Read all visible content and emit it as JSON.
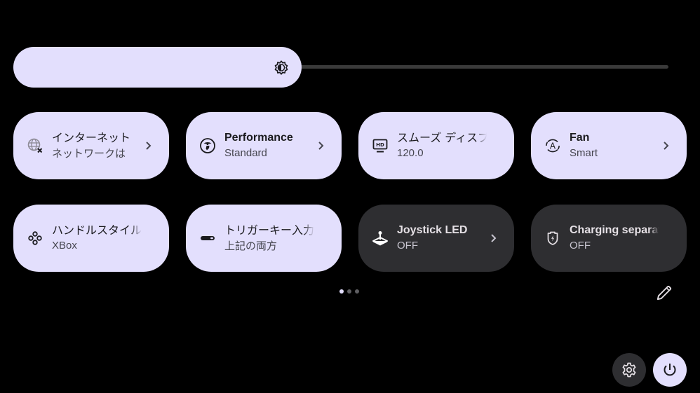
{
  "brightness": {
    "level_percent": 44,
    "icon": "brightness-auto-icon"
  },
  "tiles": [
    {
      "label": "インターネット",
      "sub": "ネットワークは",
      "state": "on",
      "icon": "globe-off-icon",
      "has_chevron": true
    },
    {
      "label": "Performance",
      "sub": "Standard",
      "state": "on",
      "icon": "performance-icon",
      "has_chevron": true
    },
    {
      "label": "スムーズ ディスプ",
      "sub": "120.0",
      "state": "on",
      "icon": "hd-display-icon",
      "has_chevron": false
    },
    {
      "label": "Fan",
      "sub": "Smart",
      "state": "on",
      "icon": "fan-auto-icon",
      "has_chevron": true
    },
    {
      "label": "ハンドルスタイル",
      "sub": "XBox",
      "state": "on",
      "icon": "gamepad-buttons-icon",
      "has_chevron": false
    },
    {
      "label": "トリガーキー入力",
      "sub": "上記の両方",
      "state": "on",
      "icon": "trigger-key-icon",
      "has_chevron": false
    },
    {
      "label": "Joystick LED",
      "sub": "OFF",
      "state": "off",
      "icon": "joystick-icon",
      "has_chevron": true
    },
    {
      "label": "Charging separation",
      "sub": "OFF",
      "state": "off",
      "icon": "battery-shield-icon",
      "has_chevron": false
    }
  ],
  "pagination": {
    "total_pages": 3,
    "current_page": 1
  },
  "actions": {
    "edit_icon": "pencil-icon",
    "settings_icon": "gear-icon",
    "power_icon": "power-icon"
  },
  "colors": {
    "tile_on": "#e3dffd",
    "tile_off": "#2e2e31",
    "background": "#000000"
  }
}
